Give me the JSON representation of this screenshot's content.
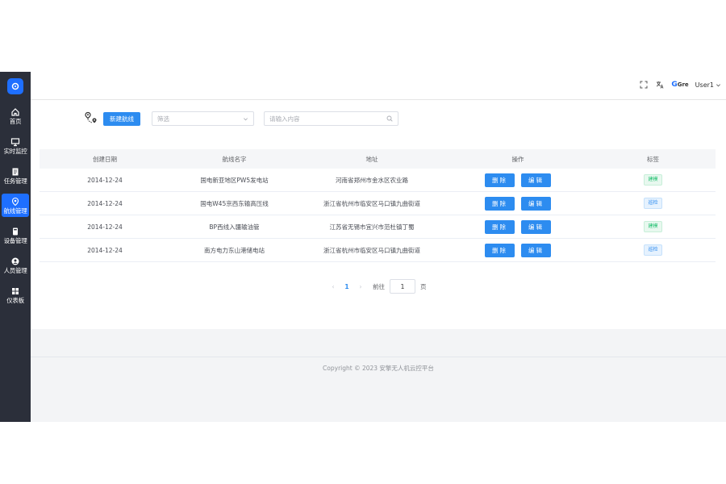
{
  "sidebar": {
    "items": [
      {
        "label": "首页",
        "icon": "home-icon"
      },
      {
        "label": "实时监控",
        "icon": "monitor-icon"
      },
      {
        "label": "任务管理",
        "icon": "task-icon"
      },
      {
        "label": "航线管理",
        "icon": "route-icon",
        "active": true
      },
      {
        "label": "设备管理",
        "icon": "device-icon"
      },
      {
        "label": "人员管理",
        "icon": "user-icon"
      },
      {
        "label": "仪表板",
        "icon": "dashboard-icon"
      }
    ]
  },
  "header": {
    "brand": "Gre",
    "username": "User1"
  },
  "toolbar": {
    "new_route_label": "新建航线",
    "filter_placeholder": "筛选",
    "search_placeholder": "请输入内容"
  },
  "table": {
    "columns": [
      "创建日期",
      "航线名字",
      "地址",
      "操作",
      "标签"
    ],
    "delete_label": "删除",
    "edit_label": "编辑",
    "rows": [
      {
        "date": "2014-12-24",
        "name": "国电新亚地区PW5发电站",
        "address": "河南省郑州市金水区农业路",
        "tag": "建模",
        "tag_type": "green"
      },
      {
        "date": "2014-12-24",
        "name": "国电W45京西东输高压线",
        "address": "浙江省杭州市临安区马口镇九曲街道",
        "tag": "巡检",
        "tag_type": "blue"
      },
      {
        "date": "2014-12-24",
        "name": "BP西线入疆输油管",
        "address": "江苏省无锡市宜兴市范杜镇丁蜀",
        "tag": "建模",
        "tag_type": "green"
      },
      {
        "date": "2014-12-24",
        "name": "南方电力东山港储电站",
        "address": "浙江省杭州市临安区马口镇九曲街道",
        "tag": "巡检",
        "tag_type": "blue"
      }
    ]
  },
  "pagination": {
    "current": "1",
    "goto_label": "前往",
    "goto_value": "1",
    "page_suffix": "页"
  },
  "footer": {
    "copyright": "Copyright © 2023 安擎无人机云控平台"
  },
  "colors": {
    "sidebar_bg": "#2b2f3a",
    "accent": "#2d8cf0",
    "active_nav": "#1e6fff"
  }
}
